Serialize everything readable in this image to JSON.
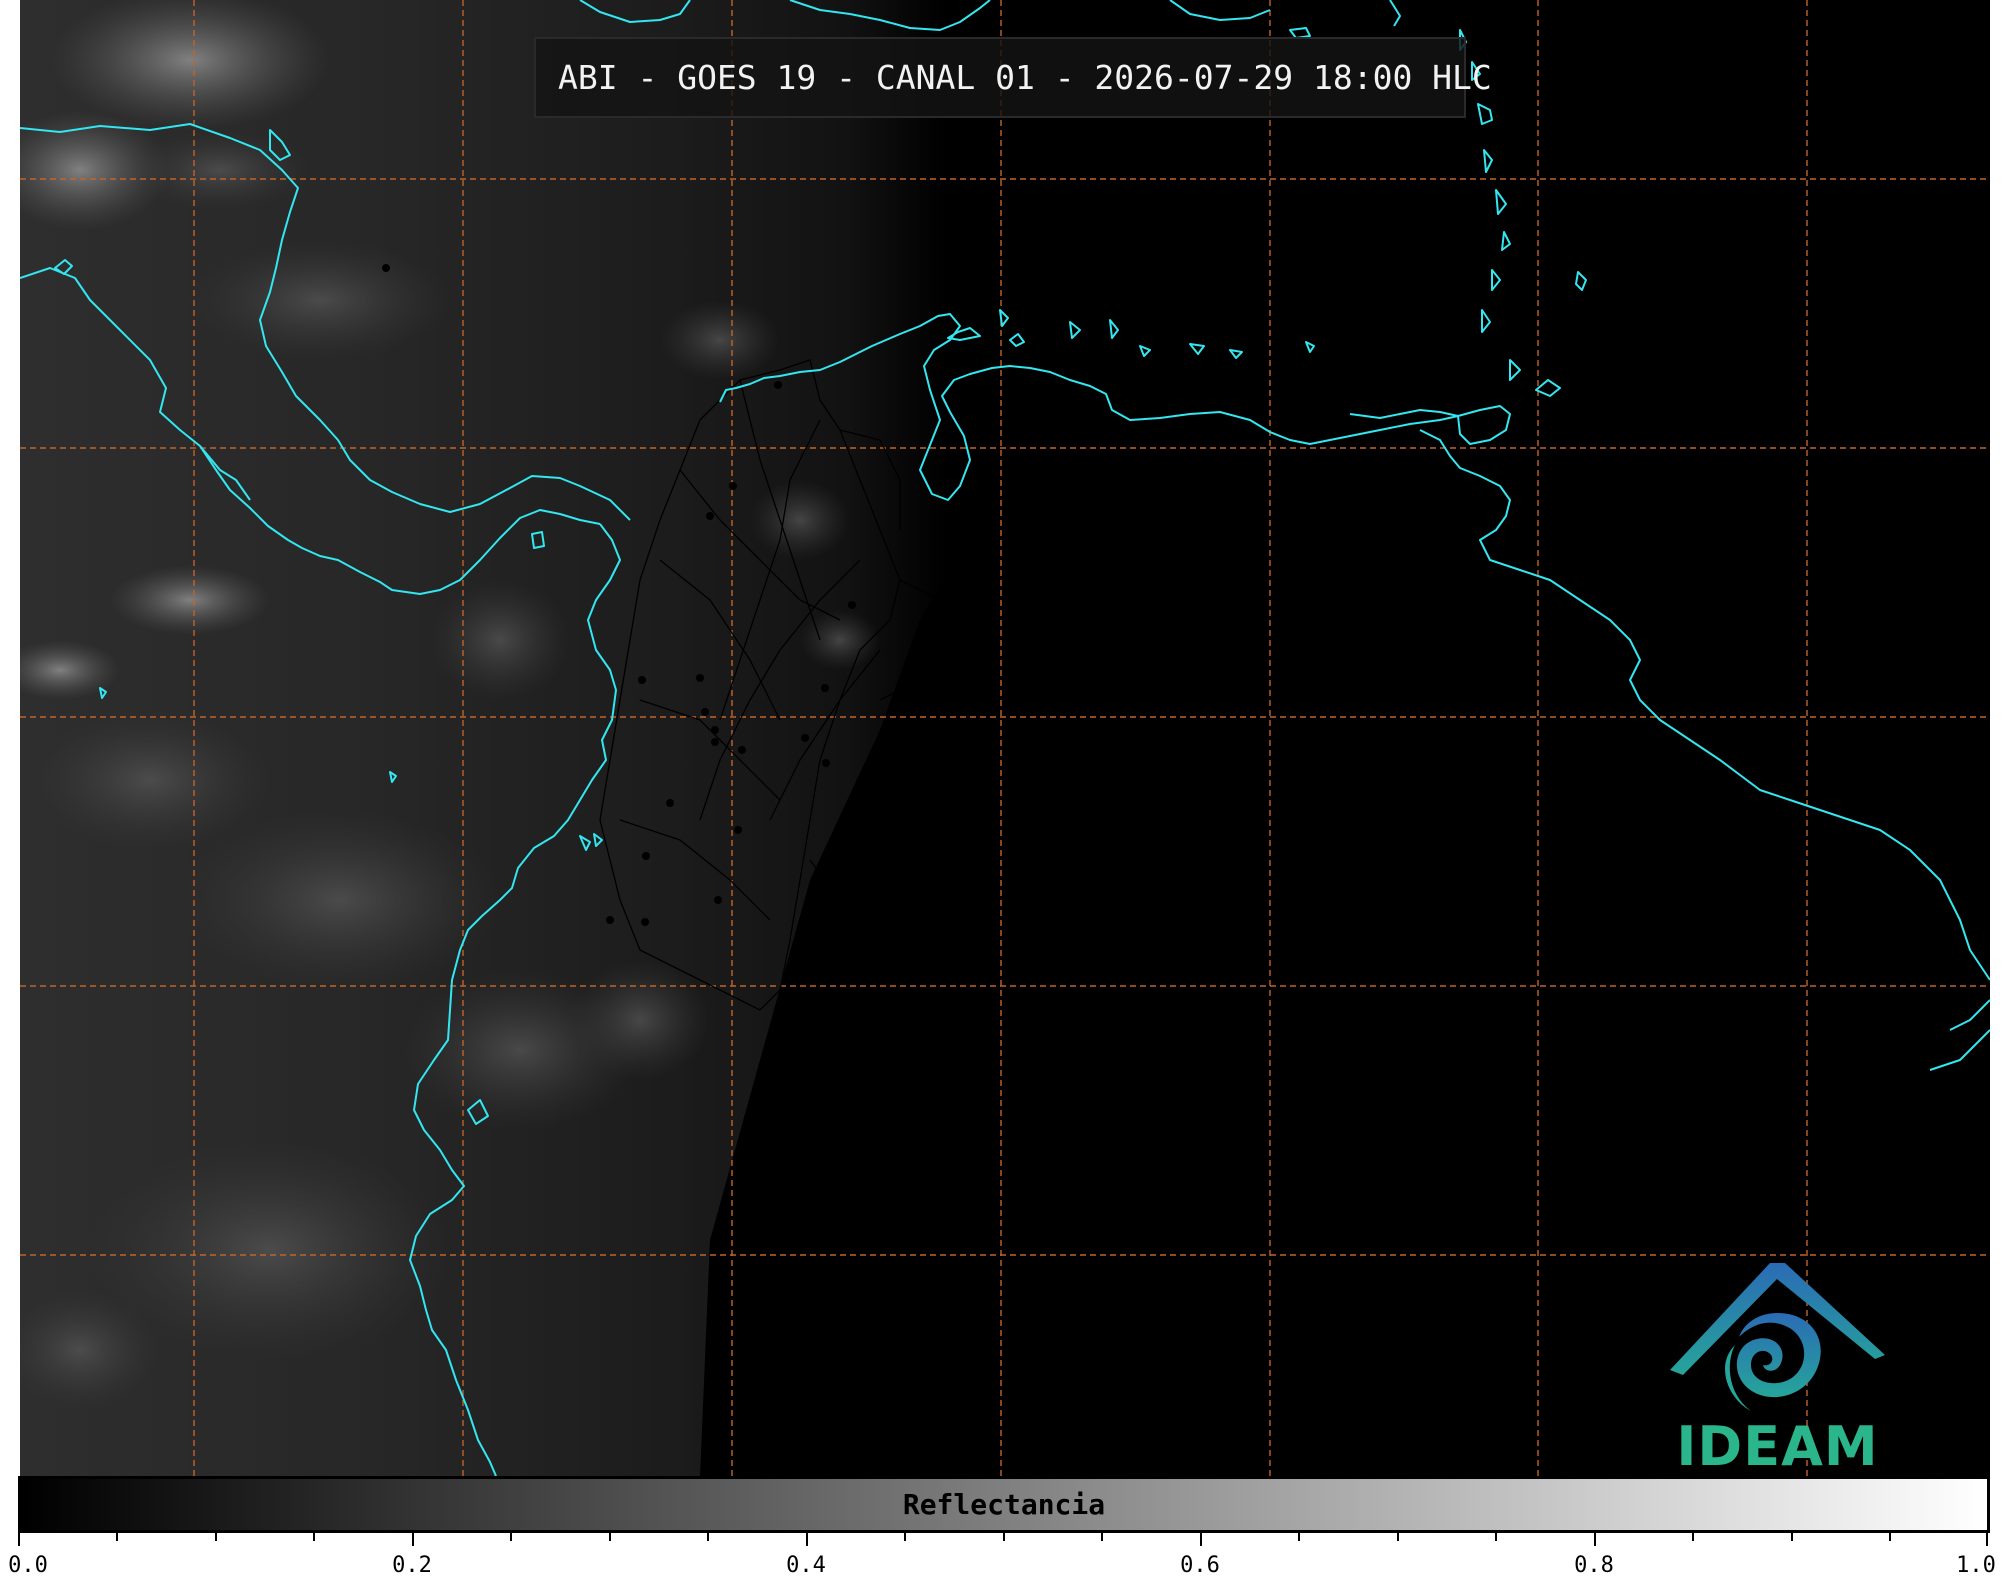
{
  "title": "ABI - GOES 19 - CANAL 01 - 2026-07-29 18:00 HLC",
  "colorbar": {
    "label": "Reflectancia",
    "tick_labels": [
      "0.0",
      "0.2",
      "0.4",
      "0.6",
      "0.8",
      "1.0"
    ],
    "range": [
      0.0,
      1.0
    ],
    "gradient": [
      "#000000",
      "#ffffff"
    ]
  },
  "logo": {
    "text": "IDEAM",
    "text_color": "#2bb58a",
    "emblem_colors": [
      "#2a6bb5",
      "#26a59a"
    ]
  },
  "colors": {
    "coastline": "#33e6f0",
    "gridlines": "#c0642a",
    "borders": "#000000"
  }
}
